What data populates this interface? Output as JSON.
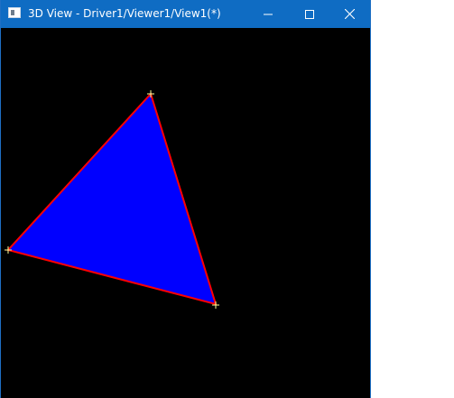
{
  "window": {
    "title": "3D View - Driver1/Viewer1/View1(*)",
    "titlebar_color": "#0f6cc3"
  },
  "controls": {
    "minimize_icon": "minimize-icon",
    "maximize_icon": "maximize-icon",
    "close_icon": "close-icon"
  },
  "scene": {
    "background": "#000000",
    "triangle": {
      "fill": "#0000ff",
      "stroke": "#ff0000"
    },
    "vertex_marker_color": "#ffff99"
  }
}
